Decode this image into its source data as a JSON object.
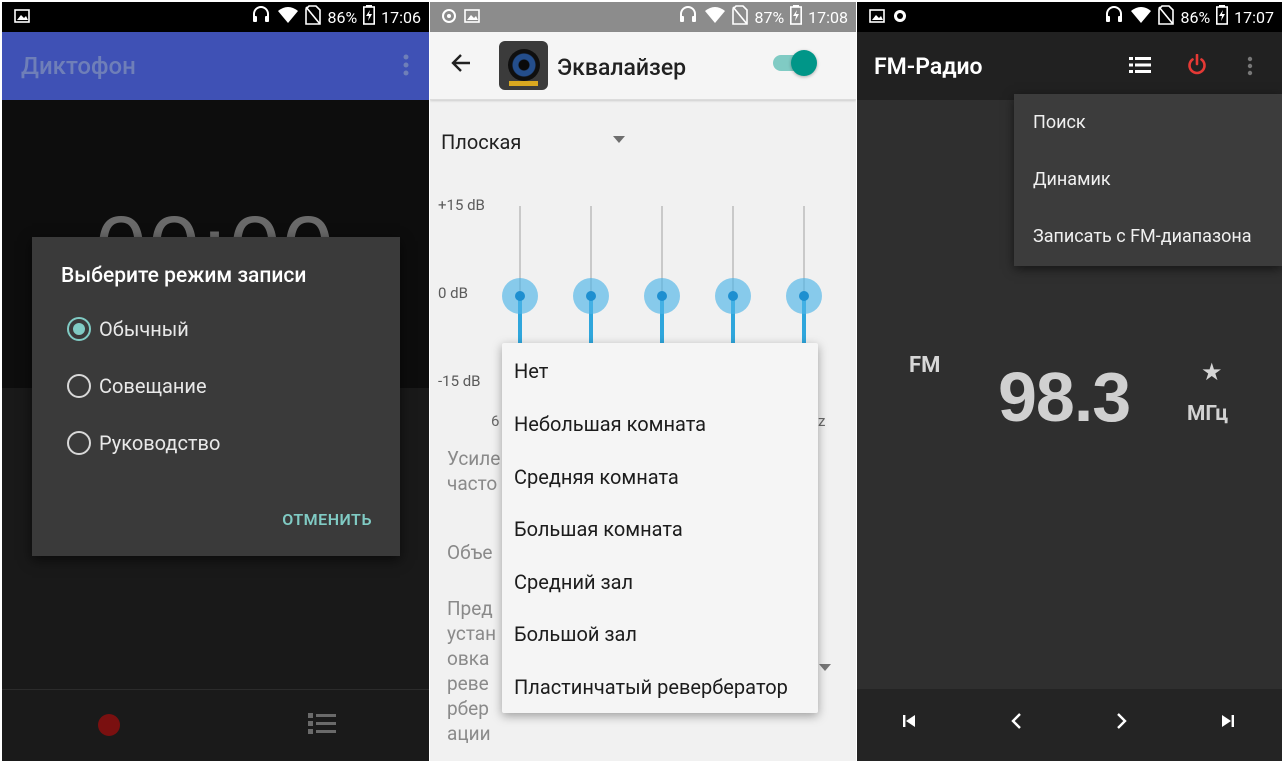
{
  "screens": [
    {
      "status": {
        "battery": "86%",
        "time": "17:06"
      },
      "app_title": "Диктофон",
      "timer": "00:00",
      "dialog": {
        "title": "Выберите режим записи",
        "options": [
          {
            "label": "Обычный",
            "selected": true
          },
          {
            "label": "Совещание",
            "selected": false
          },
          {
            "label": "Руководство",
            "selected": false
          }
        ],
        "cancel_label": "ОТМЕНИТЬ"
      }
    },
    {
      "status": {
        "battery": "87%",
        "time": "17:08"
      },
      "app_title": "Эквалайзер",
      "toggle_on": true,
      "preset": "Плоская",
      "db_labels": [
        "+15 dB",
        "0 dB",
        "-15 dB"
      ],
      "freq_left_fragment": "6",
      "freq_right_fragment": "z",
      "behind_labels": {
        "bass_fragment": "Усиле\nчасто",
        "virtualizer_fragment": "Объе",
        "reverb_fragment": "Пред\nустан\nовка\nреве\nрбер\nации"
      },
      "popup_options": [
        "Нет",
        "Небольшая комната",
        "Средняя комната",
        "Большая комната",
        "Средний зал",
        "Большой зал",
        "Пластинчатый реверберaтор"
      ]
    },
    {
      "status": {
        "battery": "86%",
        "time": "17:07"
      },
      "app_title": "FM-Радио",
      "band": "FM",
      "frequency": "98.3",
      "unit": "МГц",
      "menu": [
        "Поиск",
        "Динамик",
        "Записать с FM-диапазона"
      ]
    }
  ],
  "colors": {
    "teal": "#80cbc4",
    "teal_dark": "#009688",
    "eq_blue": "#2fa6dc",
    "power_red": "#e53935",
    "indigo": "#3f51b5"
  },
  "icons": [
    "image-icon",
    "headset-icon",
    "wifi-icon",
    "no-sim-icon",
    "battery-charging-icon",
    "back-arrow-icon",
    "more-vert-icon",
    "list-icon",
    "power-icon",
    "star-icon",
    "skip-previous-icon",
    "chevron-left-icon",
    "chevron-right-icon",
    "skip-next-icon",
    "record-icon"
  ]
}
